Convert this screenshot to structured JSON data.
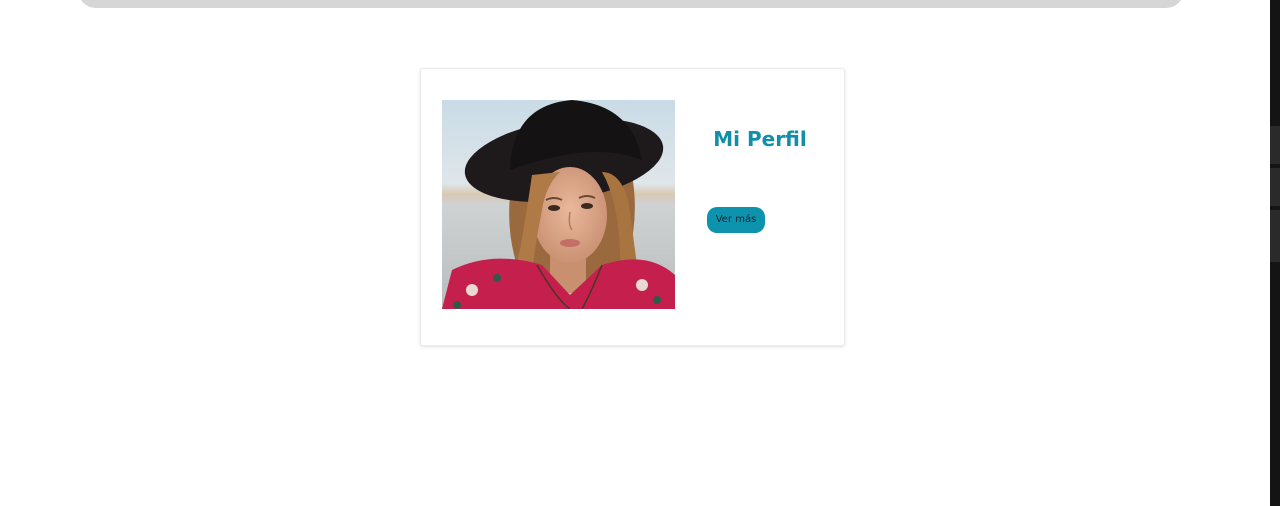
{
  "profile_card": {
    "title": "Mi Perfil",
    "button_label": "Ver más",
    "photo_alt": "profile-photo"
  },
  "colors": {
    "accent": "#118fa8",
    "button_bg": "#0d93ad",
    "top_bar": "#d6d6d6",
    "background": "#ffffff"
  }
}
